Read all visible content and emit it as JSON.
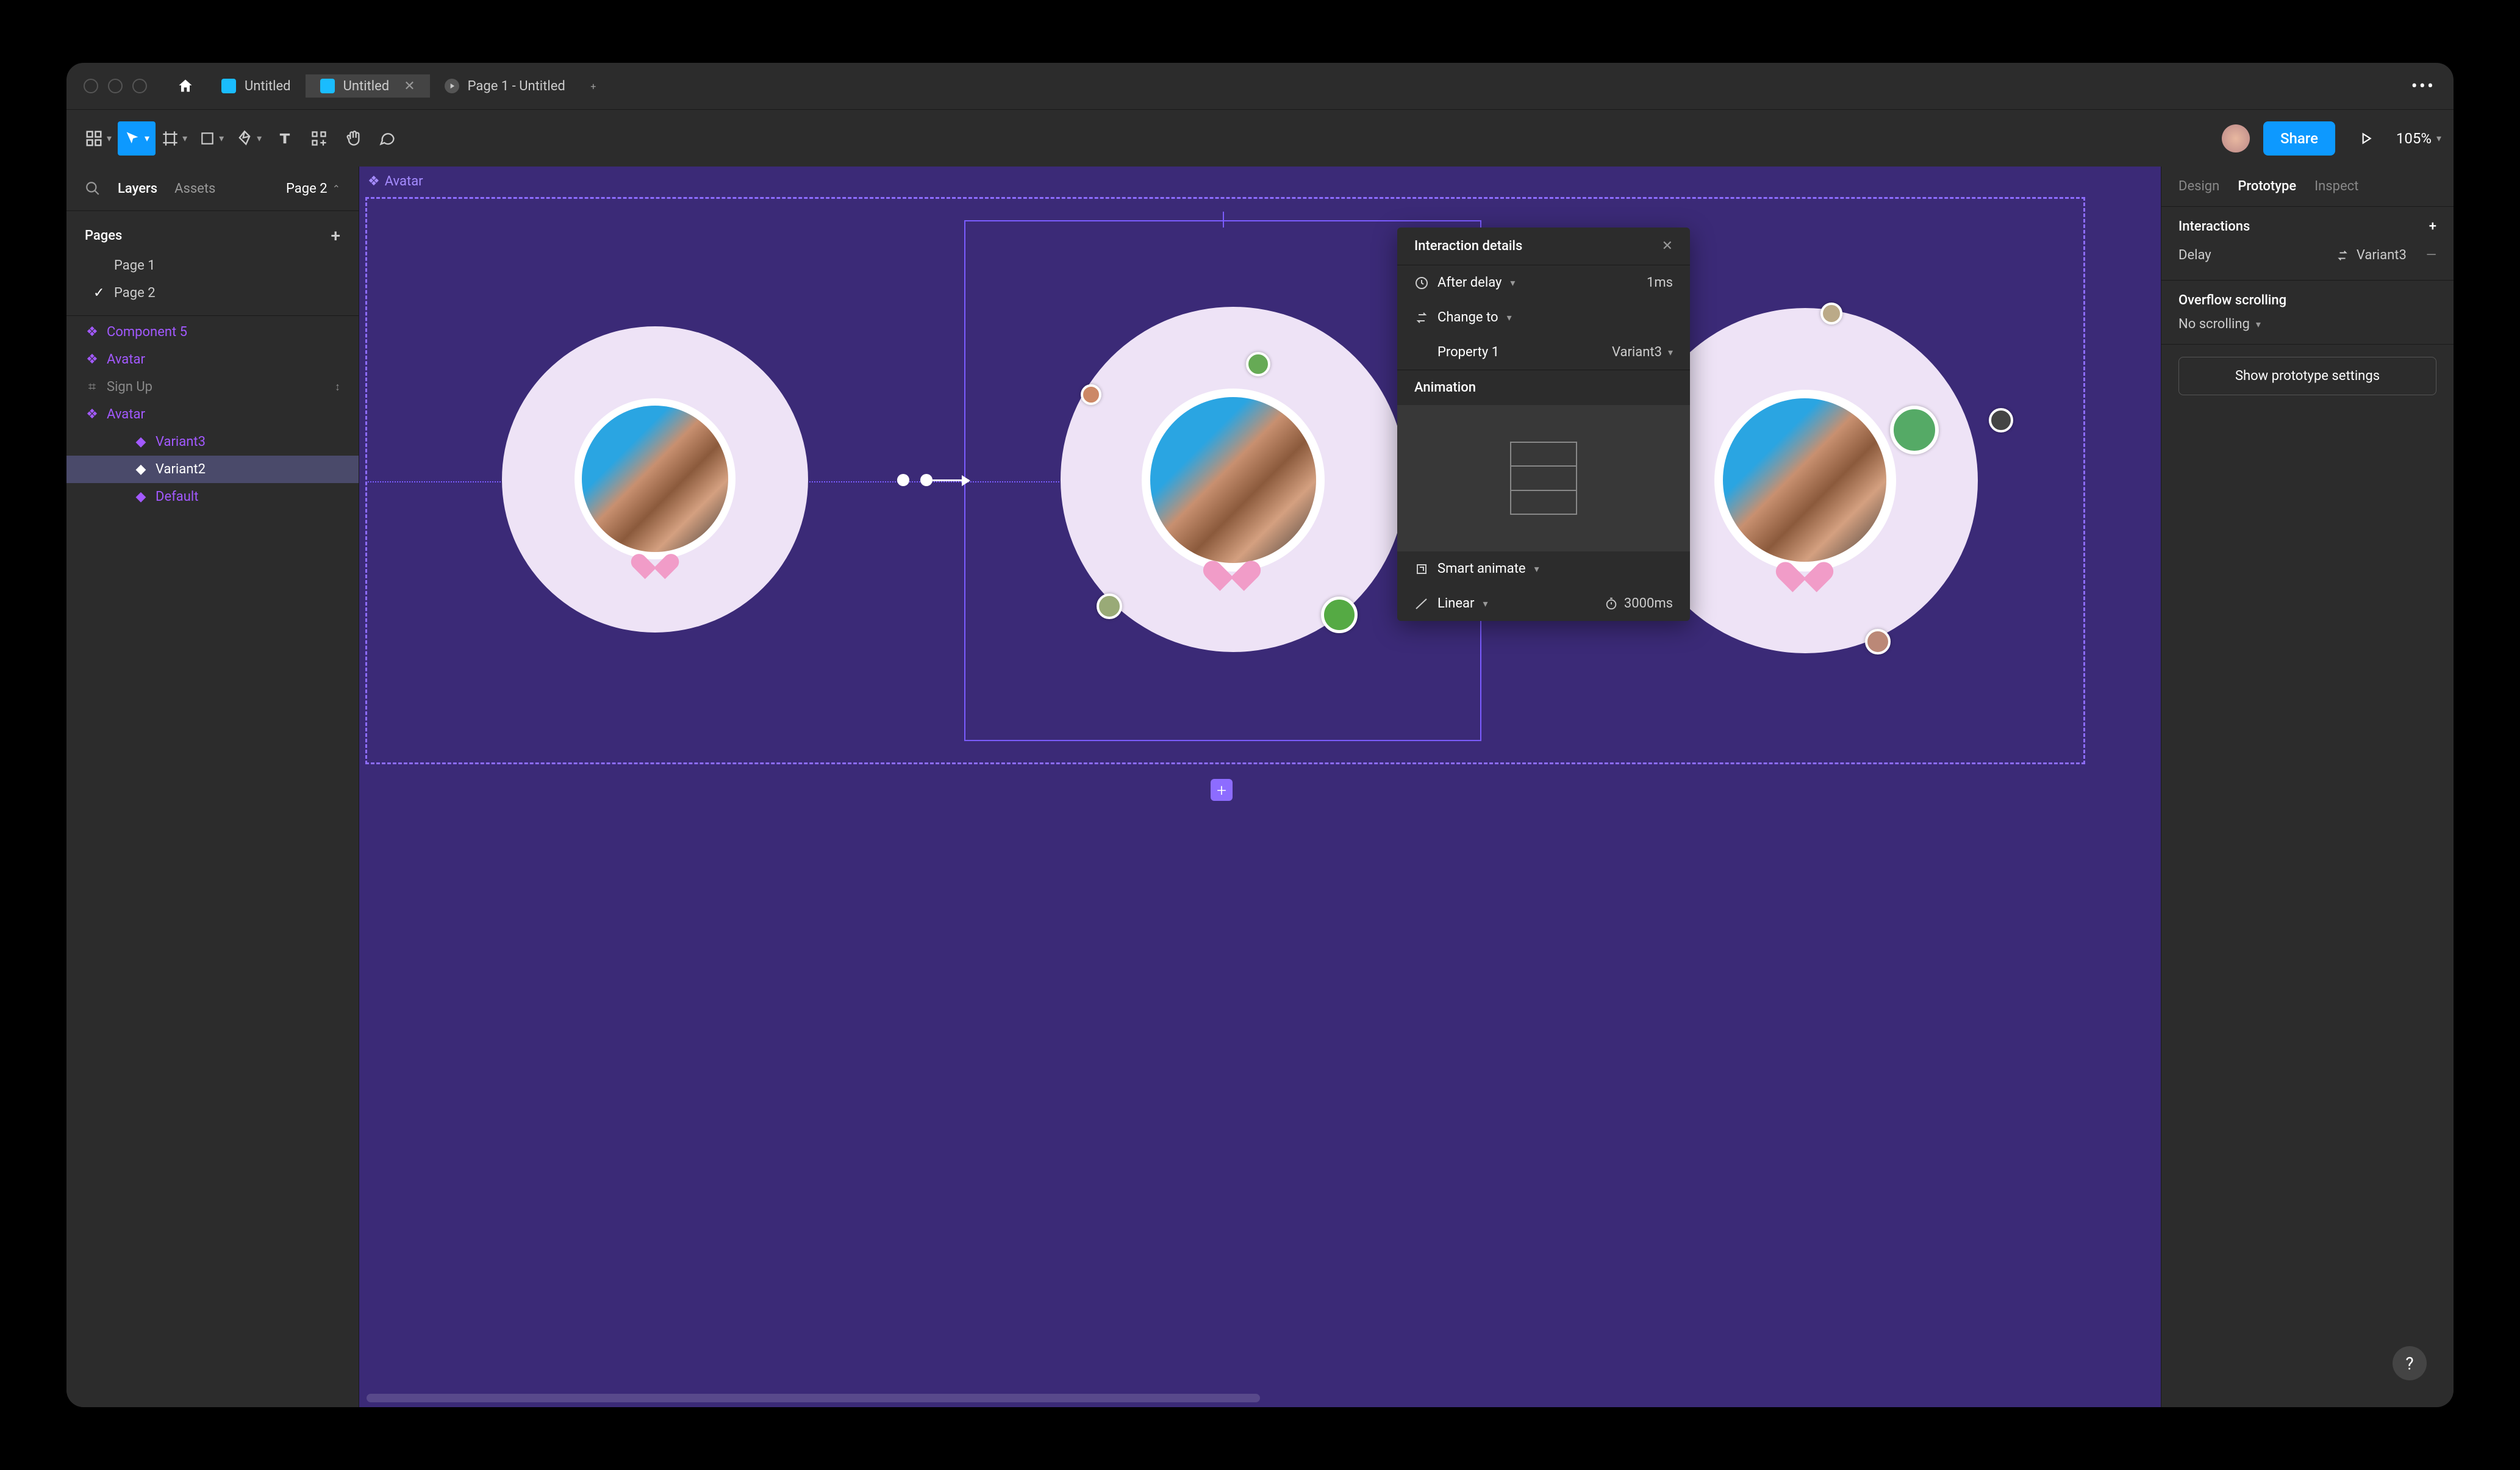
{
  "titlebar": {
    "tabs": [
      {
        "label": "Untitled",
        "active": false,
        "icon": "figma"
      },
      {
        "label": "Untitled",
        "active": true,
        "icon": "figma"
      },
      {
        "label": "Page 1 - Untitled",
        "active": false,
        "icon": "proto"
      }
    ]
  },
  "toolbar": {
    "share_label": "Share",
    "zoom": "105%"
  },
  "left_panel": {
    "tabs": {
      "layers": "Layers",
      "assets": "Assets"
    },
    "page_selector": "Page 2",
    "pages_header": "Pages",
    "pages": [
      "Page 1",
      "Page 2"
    ],
    "active_page_index": 1,
    "layers": [
      {
        "label": "Component 5",
        "type": "component"
      },
      {
        "label": "Avatar",
        "type": "component"
      },
      {
        "label": "Sign Up",
        "type": "frame",
        "muted": true,
        "pin": true
      },
      {
        "label": "Avatar",
        "type": "component"
      },
      {
        "label": "Variant3",
        "type": "variant",
        "indent": 2
      },
      {
        "label": "Variant2",
        "type": "variant",
        "indent": 2,
        "selected": true
      },
      {
        "label": "Default",
        "type": "variant",
        "indent": 2
      }
    ]
  },
  "canvas": {
    "frame_label": "Avatar"
  },
  "popup": {
    "title": "Interaction details",
    "trigger_row": {
      "icon": "clock-icon",
      "label": "After delay",
      "value": "1ms"
    },
    "action_row": {
      "icon": "swap-icon",
      "label": "Change to",
      "value": ""
    },
    "property_row": {
      "label": "Property 1",
      "value": "Variant3"
    },
    "section_animation": "Animation",
    "animate_row": {
      "icon": "bolt-icon",
      "label": "Smart animate"
    },
    "curve_row": {
      "icon": "curve-icon",
      "label": "Linear",
      "duration_icon": "stopwatch-icon",
      "duration": "3000ms"
    }
  },
  "right_panel": {
    "tabs": {
      "design": "Design",
      "prototype": "Prototype",
      "inspect": "Inspect"
    },
    "interactions_header": "Interactions",
    "interaction": {
      "trigger": "Delay",
      "target": "Variant3"
    },
    "overflow_header": "Overflow scrolling",
    "overflow_value": "No scrolling",
    "proto_settings": "Show prototype settings"
  },
  "help": "?"
}
